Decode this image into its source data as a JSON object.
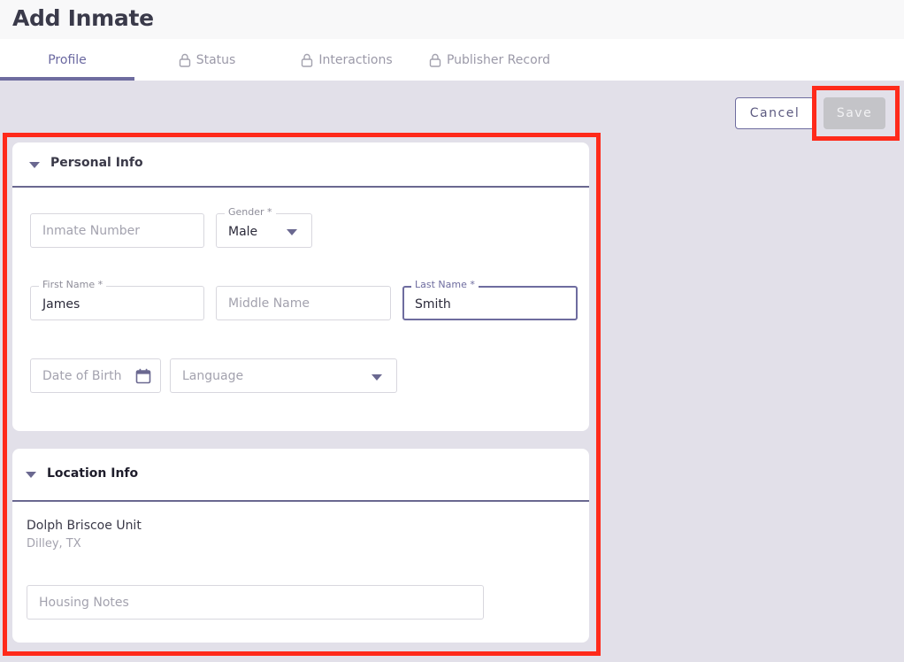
{
  "page": {
    "title": "Add Inmate"
  },
  "tabs": [
    {
      "label": "Profile",
      "locked": false
    },
    {
      "label": "Status",
      "locked": true
    },
    {
      "label": "Interactions",
      "locked": true
    },
    {
      "label": "Publisher Record",
      "locked": true
    }
  ],
  "actions": {
    "cancel_label": "Cancel",
    "save_label": "Save"
  },
  "personal": {
    "title": "Personal Info",
    "inmate_number": {
      "placeholder": "Inmate Number",
      "value": ""
    },
    "gender": {
      "label": "Gender *",
      "value": "Male"
    },
    "first_name": {
      "label": "First Name *",
      "value": "James"
    },
    "middle_name": {
      "placeholder": "Middle Name",
      "value": ""
    },
    "last_name": {
      "label": "Last Name *",
      "value": "Smith"
    },
    "dob": {
      "placeholder": "Date of Birth",
      "value": ""
    },
    "language": {
      "placeholder": "Language",
      "value": ""
    }
  },
  "location": {
    "title": "Location Info",
    "facility_name": "Dolph Briscoe Unit",
    "facility_city": "Dilley, TX",
    "housing_notes": {
      "placeholder": "Housing Notes",
      "value": ""
    }
  },
  "colors": {
    "accent": "#6e6c9f",
    "highlight": "#ff2a1a",
    "background": "#e2e0e9"
  }
}
